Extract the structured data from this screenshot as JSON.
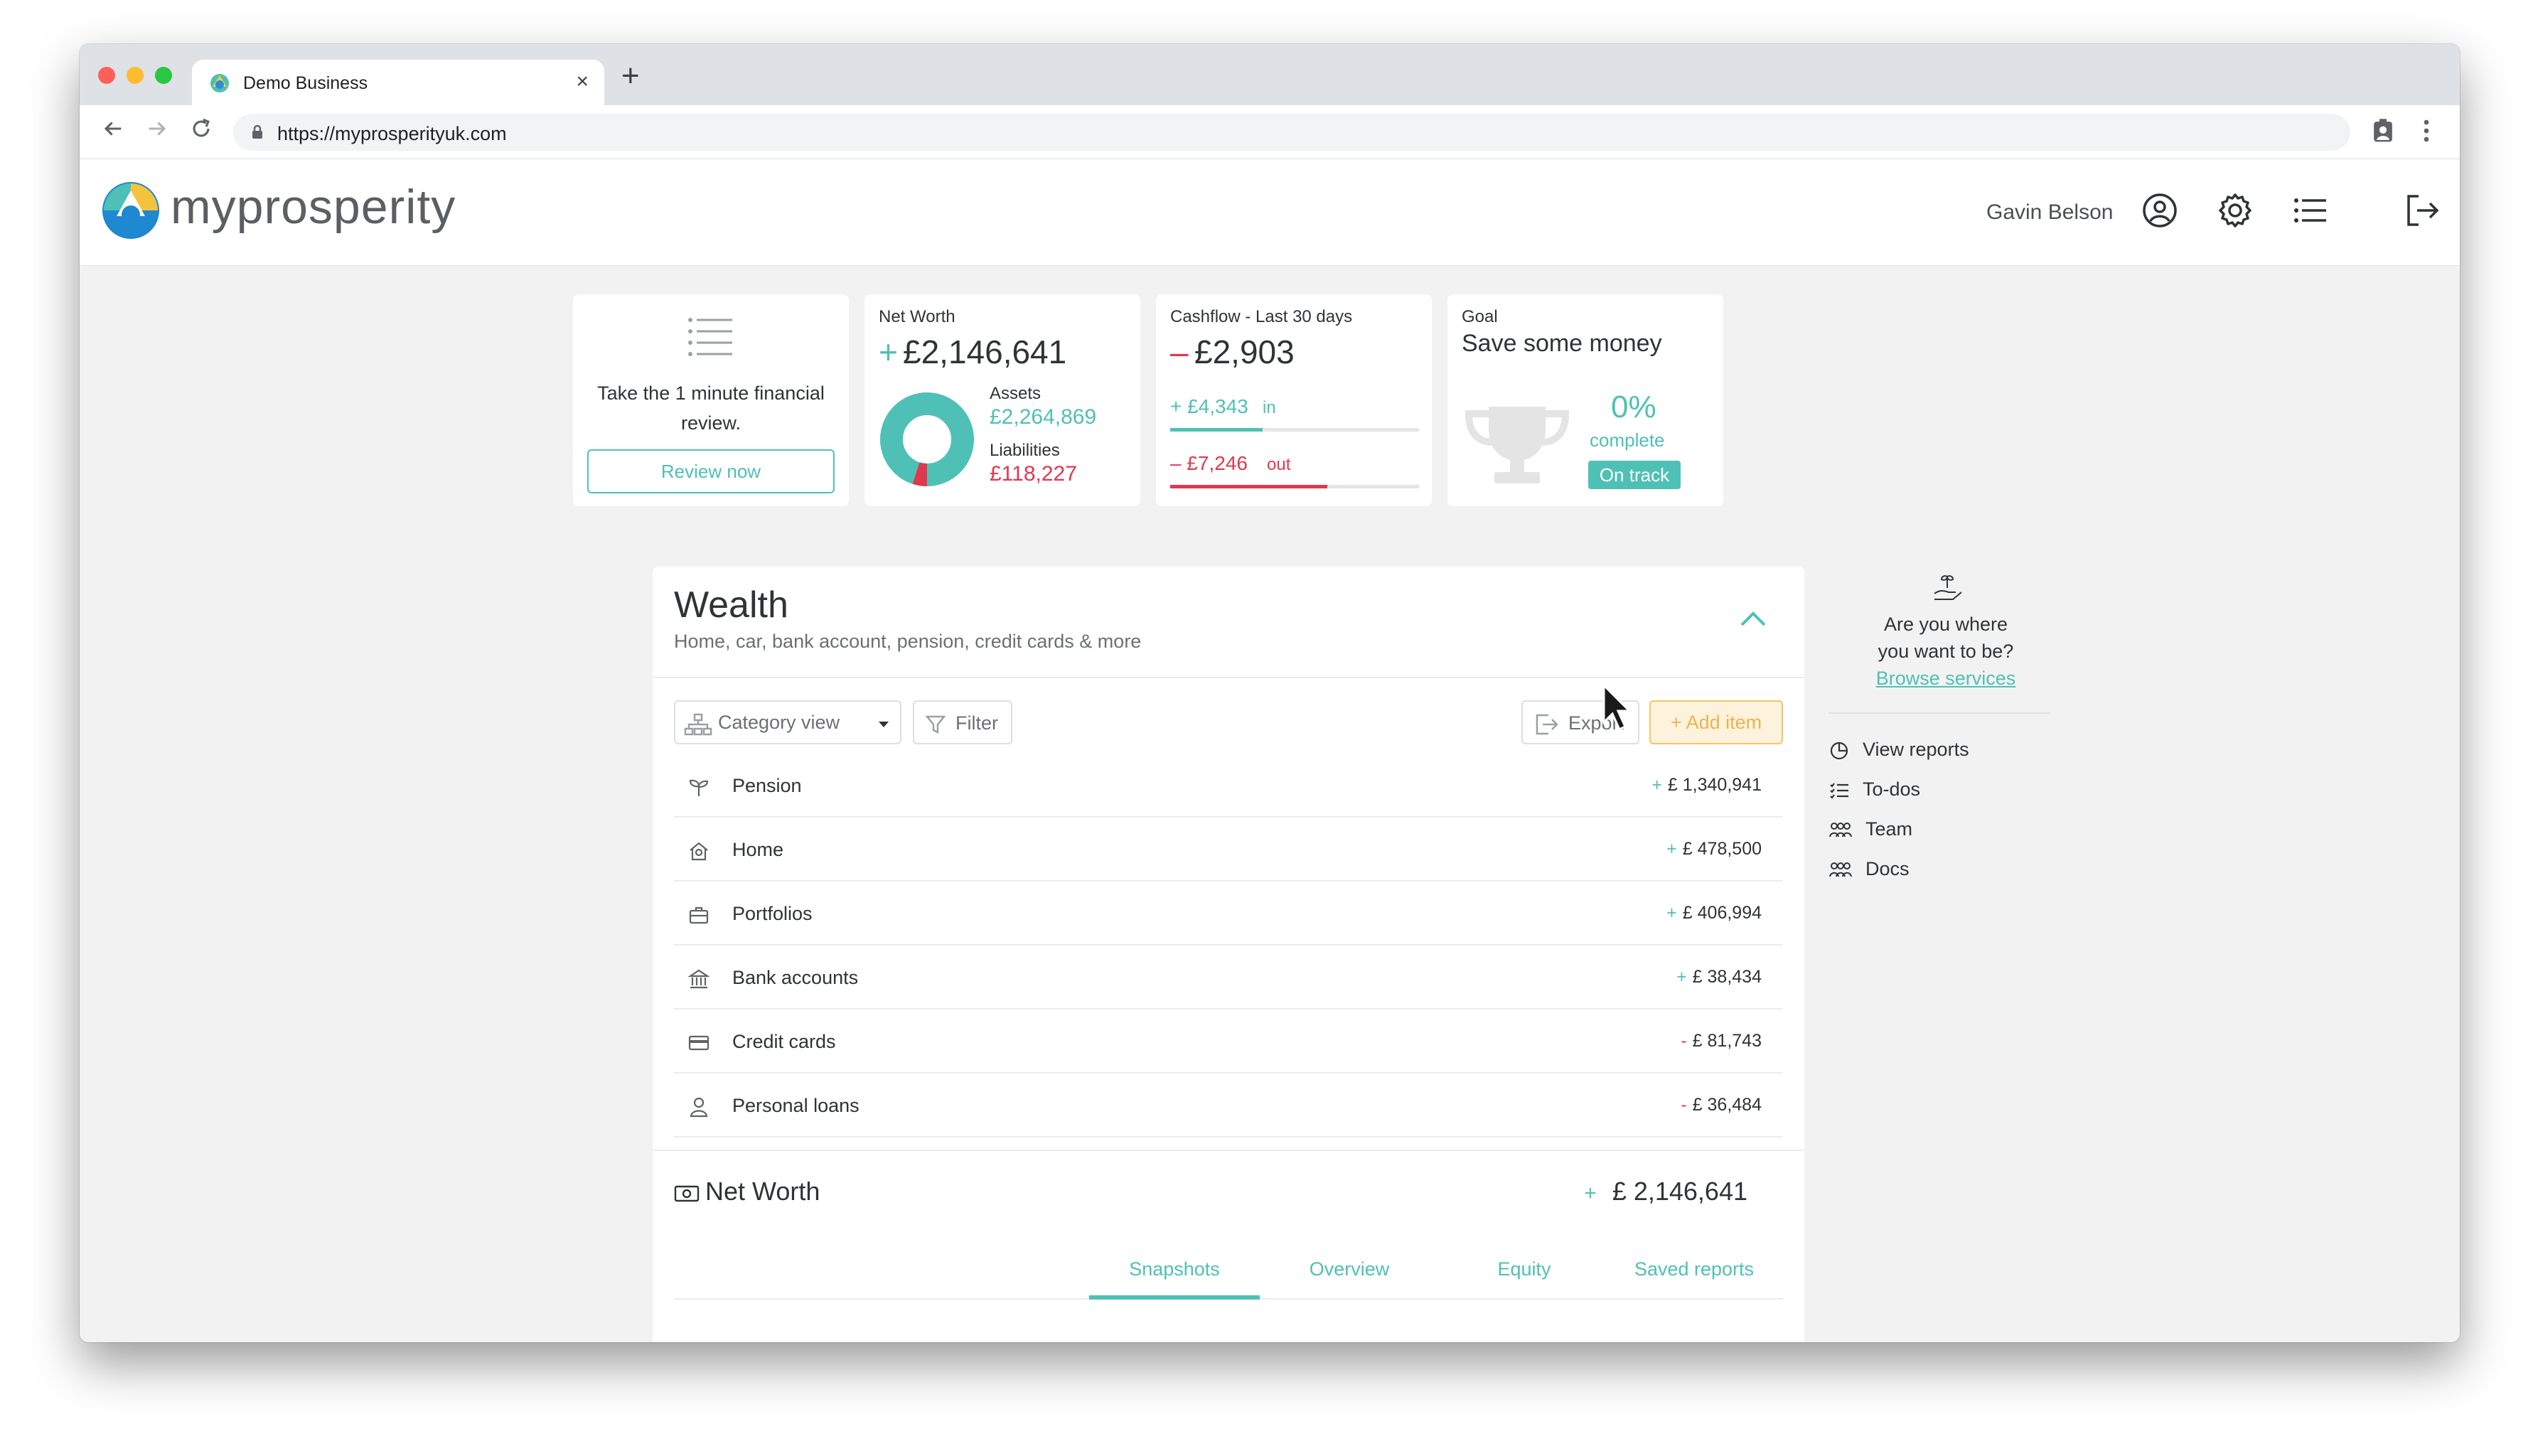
{
  "browser": {
    "tab_title": "Demo Business",
    "tab_close": "×",
    "new_tab": "+",
    "url": "https://myprosperityuk.com"
  },
  "app": {
    "logo_text": "myprosperity",
    "user_name": "Gavin Belson",
    "icons": [
      "user-circle-icon",
      "gear-icon",
      "menu-list-icon",
      "logout-icon"
    ]
  },
  "review_card": {
    "text": "Take the 1 minute financial review.",
    "button": "Review now"
  },
  "net_worth_card": {
    "label": "Net Worth",
    "sign": "+",
    "value": "£2,146,641",
    "assets_label": "Assets",
    "assets_value": "£2,264,869",
    "liabilities_label": "Liabilities",
    "liabilities_value": "£118,227",
    "liabilities_fraction": 0.05
  },
  "cashflow_card": {
    "label": "Cashflow - Last 30 days",
    "sign": "–",
    "value": "£2,903",
    "in_amount": "+ £4,343",
    "in_label": "in",
    "out_amount": "– £7,246",
    "out_label": "out",
    "in_fraction": 0.37,
    "out_fraction": 0.63
  },
  "goal_card": {
    "label": "Goal",
    "title": "Save some money",
    "percent": "0%",
    "complete_label": "complete",
    "status": "On track"
  },
  "wealth": {
    "title": "Wealth",
    "subtitle": "Home, car, bank account, pension, credit cards & more",
    "view_select": "Category view",
    "filter": "Filter",
    "export": "Export",
    "add_item": "+ Add item",
    "rows": [
      {
        "label": "Pension",
        "sign": "+",
        "value": "£ 1,340,941",
        "icon": "sprout-icon"
      },
      {
        "label": "Home",
        "sign": "+",
        "value": "£ 478,500",
        "icon": "house-icon"
      },
      {
        "label": "Portfolios",
        "sign": "+",
        "value": "£ 406,994",
        "icon": "briefcase-icon"
      },
      {
        "label": "Bank accounts",
        "sign": "+",
        "value": "£ 38,434",
        "icon": "bank-icon"
      },
      {
        "label": "Credit cards",
        "sign": "-",
        "value": "£ 81,743",
        "icon": "credit-card-icon"
      },
      {
        "label": "Personal loans",
        "sign": "-",
        "value": "£ 36,484",
        "icon": "person-icon"
      }
    ],
    "total_label": "Net Worth",
    "total_sign": "+",
    "total_value": "£ 2,146,641",
    "tabs": [
      "Snapshots",
      "Overview",
      "Equity",
      "Saved reports"
    ]
  },
  "sidebar": {
    "prompt_line1": "Are you where",
    "prompt_line2": "you want to be?",
    "link": "Browse services",
    "links": [
      "View reports",
      "To-dos",
      "Team",
      "Docs"
    ]
  },
  "colors": {
    "accent": "#4fc0b5",
    "negative": "#e0384f",
    "add_button_bg": "#fdf3dc",
    "add_button_border": "#f5c46a"
  }
}
